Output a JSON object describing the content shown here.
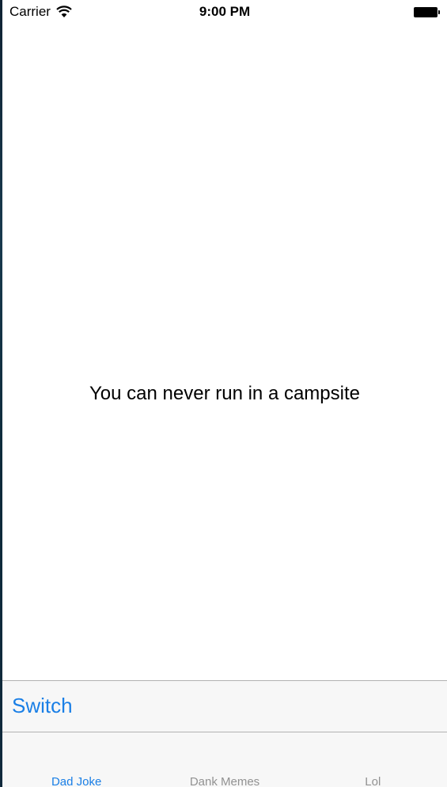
{
  "status_bar": {
    "carrier": "Carrier",
    "time": "9:00 PM",
    "wifi_icon": "wifi-icon",
    "battery_icon": "battery-icon"
  },
  "main": {
    "joke_text": "You can never run in a campsite"
  },
  "toolbar": {
    "switch_label": "Switch"
  },
  "tab_bar": {
    "tabs": [
      {
        "label": "Dad Joke",
        "active": true
      },
      {
        "label": "Dank Memes",
        "active": false
      },
      {
        "label": "Lol",
        "active": false
      }
    ]
  },
  "colors": {
    "accent": "#1a7fe6",
    "inactive_tab": "#929292",
    "bar_background": "#f7f7f7",
    "separator": "#b2b2b2"
  }
}
